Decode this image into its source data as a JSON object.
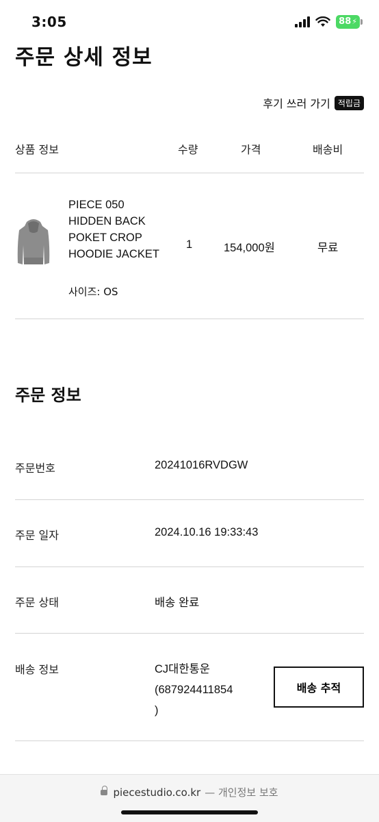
{
  "status_bar": {
    "time": "3:05",
    "battery": "88"
  },
  "page_title": "주문 상세 정보",
  "review": {
    "label": "후기 쓰러 가기",
    "badge": "적립금"
  },
  "table": {
    "headers": {
      "product": "상품 정보",
      "quantity": "수량",
      "price": "가격",
      "shipping": "배송비"
    },
    "item": {
      "name": "PIECE 050 HIDDEN BACK POKET CROP HOODIE JACKET",
      "size": "사이즈: OS",
      "quantity": "1",
      "price": "154,000원",
      "shipping": "무료"
    }
  },
  "order_info": {
    "title": "주문 정보",
    "number_label": "주문번호",
    "number": "20241016RVDGW",
    "date_label": "주문 일자",
    "date": "2024.10.16 19:33:43",
    "status_label": "주문 상태",
    "status": "배송 완료",
    "shipping_label": "배송 정보",
    "carrier": "CJ대한통운",
    "tracking_line1": "(687924411854",
    "tracking_line2": ")",
    "track_button": "배송 추적"
  },
  "browser": {
    "domain": "piecestudio.co.kr",
    "suffix": "— 개인정보 보호"
  }
}
